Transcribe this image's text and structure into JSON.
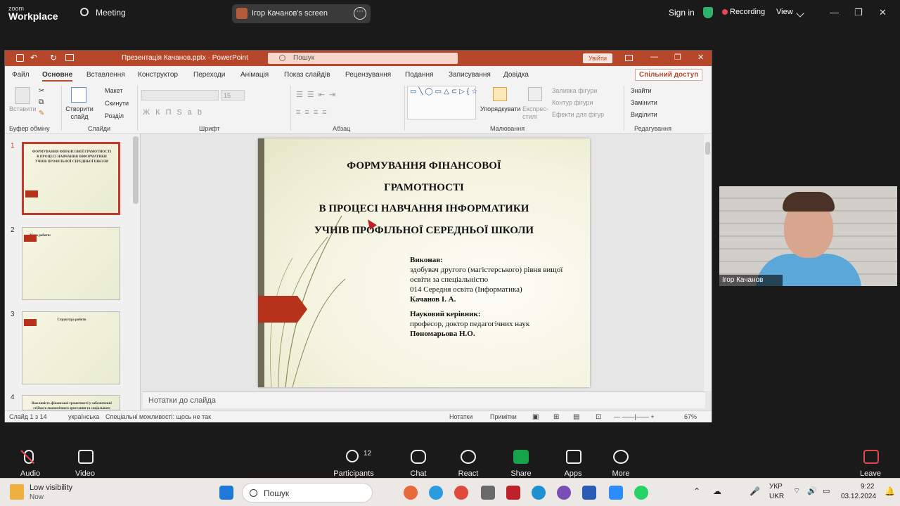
{
  "zoom": {
    "logo_small": "zoom",
    "logo_big": "Workplace",
    "meeting": "Meeting",
    "share_title": "Ігор Качанов's screen",
    "signin": "Sign in",
    "recording": "Recording",
    "view": "View",
    "bottom": {
      "audio": "Audio",
      "video": "Video",
      "participants": "Participants",
      "participants_count": "12",
      "chat": "Chat",
      "react": "React",
      "share": "Share",
      "apps": "Apps",
      "more": "More",
      "leave": "Leave"
    },
    "cam_name": "Ігор Качанов"
  },
  "ppt": {
    "title": "Презентація Качанов.pptx  ·  PowerPoint",
    "search_placeholder": "Пошук",
    "signin_button": "Увійти",
    "share_doc": "Спільний доступ",
    "tabs": [
      "Файл",
      "Основне",
      "Вставлення",
      "Конструктор",
      "Переходи",
      "Анімація",
      "Показ слайдів",
      "Рецензування",
      "Подання",
      "Записування",
      "Довідка"
    ],
    "ribbon": {
      "paste": "Вставити",
      "new_slide": "Створити слайд",
      "layout": "Макет",
      "reset": "Скинути",
      "section": "Розділ",
      "font_size": "15",
      "arrange": "Упорядкувати",
      "quick_styles": "Експрес-стилі",
      "shape_fill": "Заливка фігури",
      "shape_outline": "Контур фігури",
      "shape_effects": "Ефекти для фігур",
      "find": "Знайти",
      "replace": "Замінити",
      "select": "Виділити",
      "groups": {
        "clipboard": "Буфер обміну",
        "slides": "Слайди",
        "font": "Шрифт",
        "paragraph": "Абзац",
        "drawing": "Малювання",
        "editing": "Редагування"
      }
    },
    "slide": {
      "title1": "ФОРМУВАННЯ ФІНАНСОВОЇ",
      "title2": "ГРАМОТНОСТІ",
      "title3": "В ПРОЦЕСІ НАВЧАННЯ ІНФОРМАТИКИ",
      "title4": "УЧНІВ ПРОФІЛЬНОЇ СЕРЕДНЬОЇ ШКОЛИ",
      "author_label": "Виконав:",
      "author_line1": "здобувач другого (магістерського) рівня вищої",
      "author_line2": "освіти за спеціальністю",
      "author_line3": "014 Середня освіта (Інформатика)",
      "author_name": "Качанов І. А.",
      "supervisor_label": "Науковий керівник:",
      "supervisor_line": "професор, доктор педагогічних наук",
      "supervisor_name": "Пономарьова Н.О."
    },
    "thumbs": [
      {
        "num": "1",
        "text": "ФОРМУВАННЯ ФІНАНСОВОЇ ГРАМОТНОСТІ В ПРОЦЕСІ НАВЧАННЯ ІНФОРМАТИКИ УЧНІВ ПРОФІЛЬНОЇ СЕРЕДНЬОЇ ШКОЛИ"
      },
      {
        "num": "2",
        "text": "Мета роботи:"
      },
      {
        "num": "3",
        "text": "Структура роботи"
      },
      {
        "num": "4",
        "text": "Важливість фінансової грамотності у забезпеченні стійкого економічного зростання та соціального розвитку країни"
      }
    ],
    "notes": "Нотатки до слайда",
    "status": {
      "slide": "Слайд 1 з 14",
      "language": "українська",
      "accessibility": "Спеціальні можливості: щось не так",
      "notes": "Нотатки",
      "comments": "Примітки",
      "zoom": "67%"
    }
  },
  "taskbar": {
    "notify_title": "Low visibility",
    "notify_sub": "Now",
    "search": "Пошук",
    "lang1": "УКР",
    "lang2": "UKR",
    "time": "9:22",
    "date": "03.12.2024"
  },
  "colors": {
    "ppt_accent": "#b7472a",
    "zoom_bg": "#1a1a1a",
    "recording": "#e5484d",
    "share_green": "#16a34a"
  }
}
